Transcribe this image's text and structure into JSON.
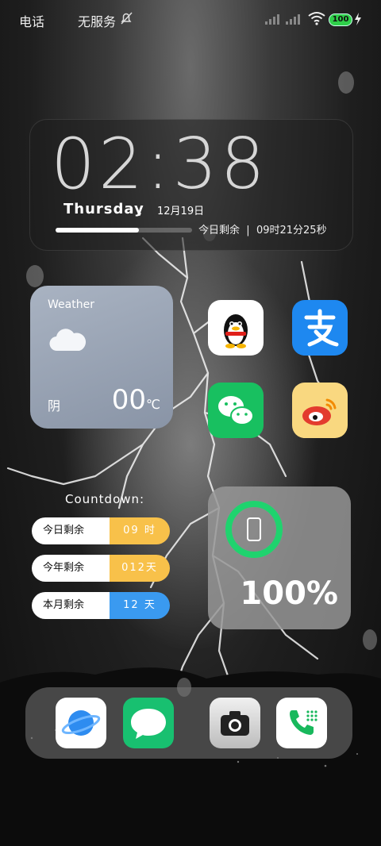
{
  "status_bar": {
    "carrier_1": "电话",
    "carrier_2": "无服务",
    "battery_level": "100"
  },
  "clock_widget": {
    "time": "02:38",
    "day": "Thursday",
    "separator": ",",
    "date": "12月19日",
    "remaining_label": "今日剩余",
    "divider": "|",
    "remaining_time": "09时21分25秒",
    "day_progress_fraction": 0.61
  },
  "weather_widget": {
    "title": "Weather",
    "condition": "阴",
    "temperature": "00",
    "unit": "℃",
    "icon": "cloud-icon"
  },
  "apps": [
    {
      "name": "qq-app",
      "icon": "penguin-icon"
    },
    {
      "name": "alipay-app",
      "icon": "alipay-icon"
    },
    {
      "name": "wechat-app",
      "icon": "wechat-icon"
    },
    {
      "name": "weibo-app",
      "icon": "weibo-icon"
    }
  ],
  "countdown": {
    "title": "Countdown:",
    "rows": [
      {
        "label": "今日剩余",
        "value": "09 时",
        "color": "#f8c14a"
      },
      {
        "label": "今年剩余",
        "value": "012天",
        "color": "#f8c14a"
      },
      {
        "label": "本月剩余",
        "value": "12 天",
        "color": "#3a9af0"
      }
    ]
  },
  "battery_widget": {
    "percent": "100%",
    "ring_color": "#1fd36e",
    "level_fraction": 1.0
  },
  "dock": [
    {
      "name": "browser-app",
      "icon": "planet-icon"
    },
    {
      "name": "messages-app",
      "icon": "chat-bubble-icon"
    },
    {
      "name": "camera-app",
      "icon": "camera-icon"
    },
    {
      "name": "phone-app",
      "icon": "phone-icon"
    }
  ]
}
